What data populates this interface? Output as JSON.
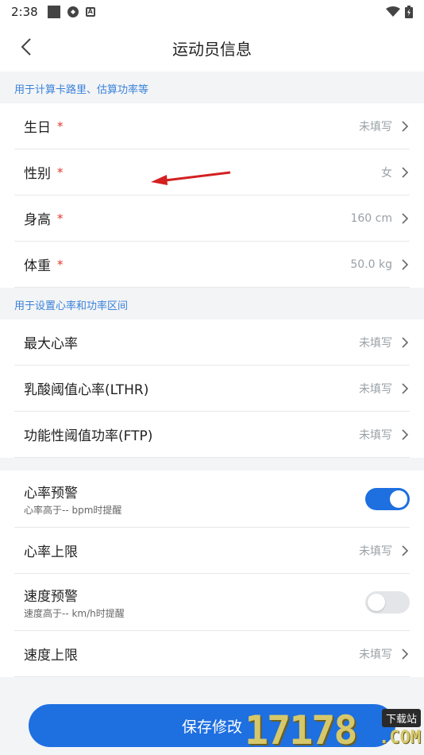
{
  "status_bar": {
    "time": "2:38"
  },
  "header": {
    "title": "运动员信息"
  },
  "sections": {
    "basic_label": "用于计算卡路里、估算功率等",
    "zones_label": "用于设置心率和功率区间"
  },
  "basic": {
    "birthday": {
      "label": "生日",
      "required": "*",
      "value": "未填写"
    },
    "gender": {
      "label": "性别",
      "required": "*",
      "value": "女"
    },
    "height": {
      "label": "身高",
      "required": "*",
      "value": "160 cm"
    },
    "weight": {
      "label": "体重",
      "required": "*",
      "value": "50.0 kg"
    }
  },
  "zones": {
    "max_hr": {
      "label": "最大心率",
      "value": "未填写"
    },
    "lthr": {
      "label": "乳酸阈值心率(LTHR)",
      "value": "未填写"
    },
    "ftp": {
      "label": "功能性阈值功率(FTP)",
      "value": "未填写"
    }
  },
  "alerts": {
    "hr_alert": {
      "label": "心率预警",
      "sub": "心率高于-- bpm时提醒",
      "enabled": true
    },
    "hr_limit": {
      "label": "心率上限",
      "value": "未填写"
    },
    "speed_alert": {
      "label": "速度预警",
      "sub": "速度高于-- km/h时提醒",
      "enabled": false
    },
    "speed_limit": {
      "label": "速度上限",
      "value": "未填写"
    }
  },
  "footer": {
    "save_label": "保存修改"
  },
  "watermark": {
    "digits": "17178",
    "tag": "下载站",
    "suffix": ".COM"
  },
  "colors": {
    "accent": "#1e6fe0",
    "section_label": "#3b82d9",
    "required": "#e5352b",
    "annotation_arrow": "#d42020"
  }
}
